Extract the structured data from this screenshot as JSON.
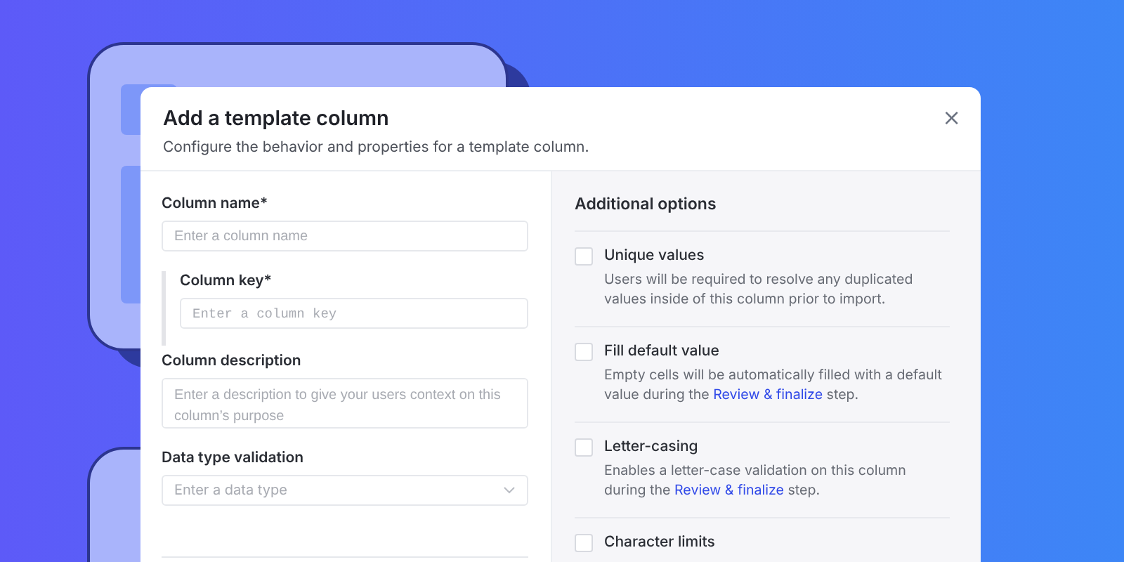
{
  "dialog": {
    "title": "Add a template column",
    "subtitle": "Configure the behavior and properties for a template column.",
    "close": "×"
  },
  "form": {
    "column_name": {
      "label": "Column name*",
      "placeholder": "Enter a column name"
    },
    "column_key": {
      "label": "Column key*",
      "placeholder": "Enter a column key"
    },
    "column_description": {
      "label": "Column description",
      "placeholder": "Enter a description to give your users context on this column’s purpose"
    },
    "data_type": {
      "label": "Data type validation",
      "placeholder": "Enter a data type"
    }
  },
  "additional_options": {
    "title": "Additional options",
    "options": [
      {
        "label": "Unique values",
        "checked": false,
        "description": "Users will be required to resolve any duplicated values inside of this column prior to import."
      },
      {
        "label": "Fill default value",
        "checked": false,
        "description": "Empty cells will be automatically filled with a default value during the",
        "link": "Review & finalize",
        "after": "step."
      },
      {
        "label": "Letter-casing",
        "checked": false,
        "description": "Enables a letter-case validation on this column during the",
        "link": "Review & finalize",
        "after": "step."
      },
      {
        "label": "Character limits",
        "checked": false
      }
    ]
  }
}
